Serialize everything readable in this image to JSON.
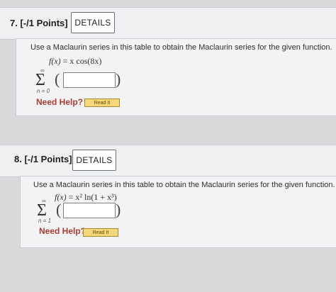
{
  "questions": [
    {
      "title": "7.  [-/1 Points]",
      "details_label": "DETAILS",
      "instruction": "Use a Maclaurin series in this table to obtain the Maclaurin series for the given function.",
      "function_lhs": "f(x)",
      "function_rhs": "= x cos(8x)",
      "sum_upper": "∞",
      "sum_lower": "n = 0",
      "need_help": "Need Help?",
      "read_it": "Read It"
    },
    {
      "title": "8.  [-/1 Points]",
      "details_label": "DETAILS",
      "instruction": "Use a Maclaurin series in this table to obtain the Maclaurin series for the given function.",
      "function_lhs": "f(x)",
      "function_rhs": "= x² ln(1 + x³)",
      "sum_upper": "∞",
      "sum_lower": "n = 1",
      "need_help": "Need Help?",
      "read_it": "Read It"
    }
  ]
}
